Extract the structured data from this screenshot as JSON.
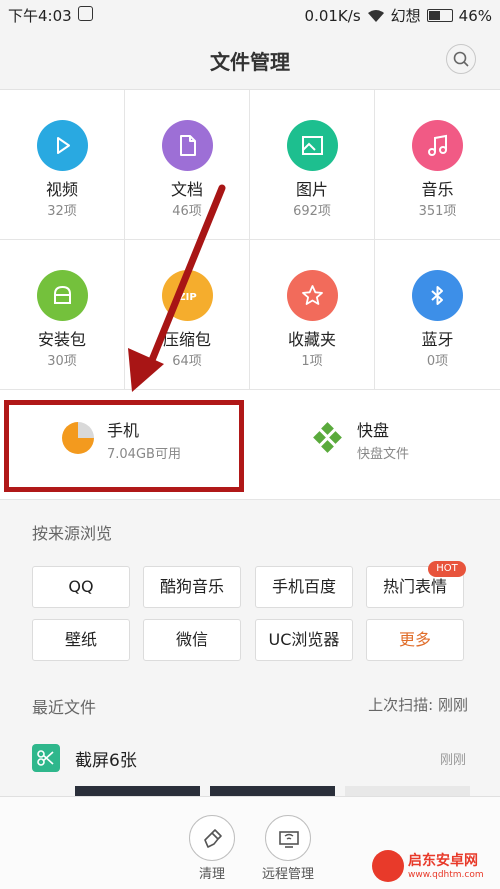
{
  "status_bar": {
    "time": "下午4:03",
    "network_speed": "0.01K/s",
    "carrier": "幻想",
    "battery": "46%",
    "battery_level": 0.46
  },
  "header": {
    "title": "文件管理",
    "search_icon": "search-icon"
  },
  "categories": [
    {
      "label": "视频",
      "count": "32项",
      "color": "#29a9e1",
      "icon": "play-icon"
    },
    {
      "label": "文档",
      "count": "46项",
      "color": "#9d6fd6",
      "icon": "document-icon"
    },
    {
      "label": "图片",
      "count": "692项",
      "color": "#1dbf8f",
      "icon": "image-icon"
    },
    {
      "label": "音乐",
      "count": "351项",
      "color": "#f15a85",
      "icon": "music-icon"
    },
    {
      "label": "安装包",
      "count": "30项",
      "color": "#74c13c",
      "icon": "android-icon"
    },
    {
      "label": "压缩包",
      "count": "64项",
      "color": "#f5ad2d",
      "icon": "zip-icon",
      "icon_text": "ZIP"
    },
    {
      "label": "收藏夹",
      "count": "1项",
      "color": "#f26b5b",
      "icon": "star-icon"
    },
    {
      "label": "蓝牙",
      "count": "0项",
      "color": "#3d8fe8",
      "icon": "bluetooth-icon"
    }
  ],
  "storage": {
    "phone": {
      "title": "手机",
      "subtitle": "7.04GB可用"
    },
    "cloud": {
      "title": "快盘",
      "subtitle": "快盘文件"
    }
  },
  "sources": {
    "heading": "按来源浏览",
    "items": [
      "QQ",
      "酷狗音乐",
      "手机百度",
      "热门表情",
      "壁纸",
      "微信",
      "UC浏览器",
      "更多"
    ],
    "hot_badge": "HOT"
  },
  "recent": {
    "heading": "最近文件",
    "last_scan": "上次扫描: 刚刚",
    "item_name": "截屏6张",
    "item_time": "刚刚"
  },
  "bottom_bar": {
    "clean_label": "清理",
    "remote_label": "远程管理"
  },
  "watermark": {
    "name": "启东安卓网",
    "url": "www.qdhtm.com"
  },
  "colors": {
    "accent_orange": "#e06d2a",
    "annotation_red": "#b01818"
  }
}
